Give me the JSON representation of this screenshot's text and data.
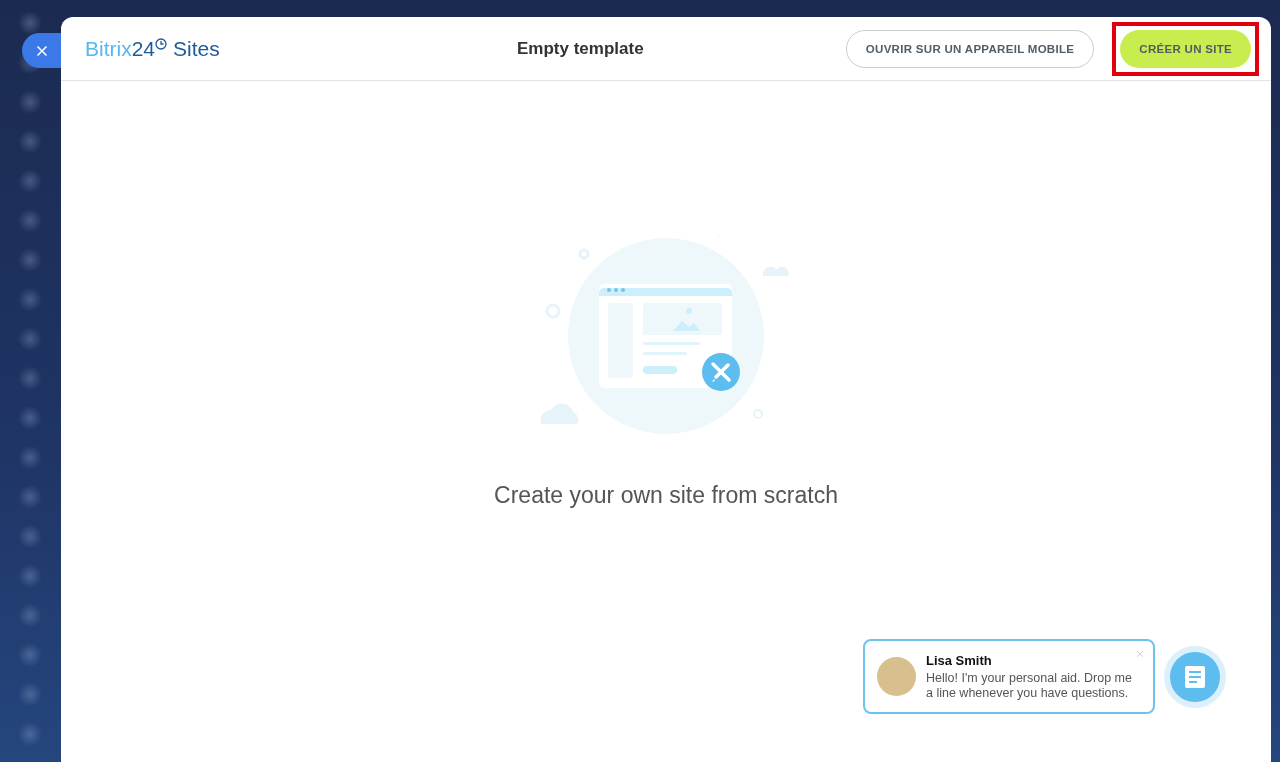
{
  "header": {
    "logo": {
      "brand_light": "Bitrix",
      "brand_dark": "24",
      "product": "Sites"
    },
    "title": "Empty template",
    "buttons": [
      {
        "kind": "outline",
        "label": "OUVRIR SUR UN APPAREIL MOBILE",
        "highlighted": false
      },
      {
        "kind": "primary",
        "label": "CRÉER UN SITE",
        "highlighted": true
      }
    ]
  },
  "empty_state": {
    "caption": "Create your own site from scratch"
  },
  "chat": {
    "name": "Lisa Smith",
    "message": "Hello! I'm your personal aid. Drop me a line whenever you have questions."
  }
}
